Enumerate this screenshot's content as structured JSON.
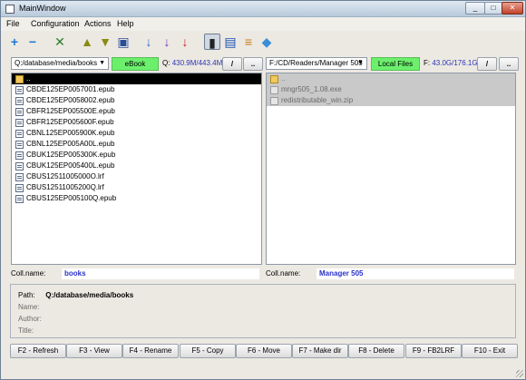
{
  "window": {
    "title": "MainWindow"
  },
  "menu": [
    "File",
    "Configuration",
    "Actions",
    "Help"
  ],
  "toolbar": {
    "icons": [
      {
        "name": "add-icon",
        "glyph": "+",
        "color": "#1d7ad1"
      },
      {
        "name": "remove-icon",
        "glyph": "−",
        "color": "#1d7ad1"
      },
      {
        "name": "tools-icon",
        "glyph": "✕",
        "color": "#2c7d2c"
      },
      {
        "name": "arrow-up-icon",
        "glyph": "▲",
        "color": "#8a8a14"
      },
      {
        "name": "arrow-down-icon",
        "glyph": "▼",
        "color": "#8a8a14"
      },
      {
        "name": "save-icon",
        "glyph": "▣",
        "color": "#2a4f9a"
      },
      {
        "name": "sort-az-icon",
        "glyph": "↓",
        "color": "#2a6fc9"
      },
      {
        "name": "sort-za-icon",
        "glyph": "↓",
        "color": "#7a33b5"
      },
      {
        "name": "sort-red-icon",
        "glyph": "↓",
        "color": "#cc2020"
      },
      {
        "name": "reader-device-icon",
        "glyph": "▮",
        "color": "#222222"
      },
      {
        "name": "ebook-icon",
        "glyph": "▤",
        "color": "#1a4fb3"
      },
      {
        "name": "books-stack-icon",
        "glyph": "≡",
        "color": "#c77a1c"
      },
      {
        "name": "eraser-icon",
        "glyph": "◆",
        "color": "#3b8fd6"
      }
    ]
  },
  "left": {
    "path": "Q:/database/media/books",
    "mode_button": "eBook",
    "stat_prefix": "Q:",
    "stat_value": "430.9M/443.4M",
    "root_button": "/",
    "up_button": "..",
    "files": [
      {
        "name": "..",
        "type": "folder",
        "selected": true
      },
      {
        "name": "CBDE125EP0057001.epub",
        "type": "doc"
      },
      {
        "name": "CBDE125EP0058002.epub",
        "type": "doc"
      },
      {
        "name": "CBFR125EP005500E.epub",
        "type": "doc"
      },
      {
        "name": "CBFR125EP005600F.epub",
        "type": "doc"
      },
      {
        "name": "CBNL125EP005900K.epub",
        "type": "doc"
      },
      {
        "name": "CBNL125EP005A00L.epub",
        "type": "doc"
      },
      {
        "name": "CBUK125EP005300K.epub",
        "type": "doc"
      },
      {
        "name": "CBUK125EP005400L.epub",
        "type": "doc"
      },
      {
        "name": "CBUS12511005000O.lrf",
        "type": "doc"
      },
      {
        "name": "CBUS12511005200Q.lrf",
        "type": "doc"
      },
      {
        "name": "CBUS125EP005100Q.epub",
        "type": "doc"
      }
    ],
    "coll_label": "Coll.name:",
    "coll_value": "books"
  },
  "right": {
    "path": "F:/CD/Readers/Manager 505",
    "mode_button": "Local Files",
    "stat_prefix": "F:",
    "stat_value": "43.0G/176.1G",
    "root_button": "/",
    "up_button": "..",
    "files": [
      {
        "name": "..",
        "type": "folder",
        "grey": true
      },
      {
        "name": "mngr505_1.08.exe",
        "type": "greydoc",
        "grey": true
      },
      {
        "name": "redistributable_win.zip",
        "type": "greydoc",
        "grey": true
      }
    ],
    "coll_label": "Coll.name:",
    "coll_value": "Manager 505"
  },
  "info": {
    "path_label": "Path:",
    "path_value": "Q:/database/media/books",
    "name_label": "Name:",
    "author_label": "Author:",
    "title_label": "Title:"
  },
  "fkeys": [
    "F2 - Refresh",
    "F3 - View",
    "F4 - Rename",
    "F5 - Copy",
    "F6 - Move",
    "F7 - Make dir",
    "F8 - Delete",
    "F9 - FB2LRF",
    "F10 - Exit"
  ]
}
